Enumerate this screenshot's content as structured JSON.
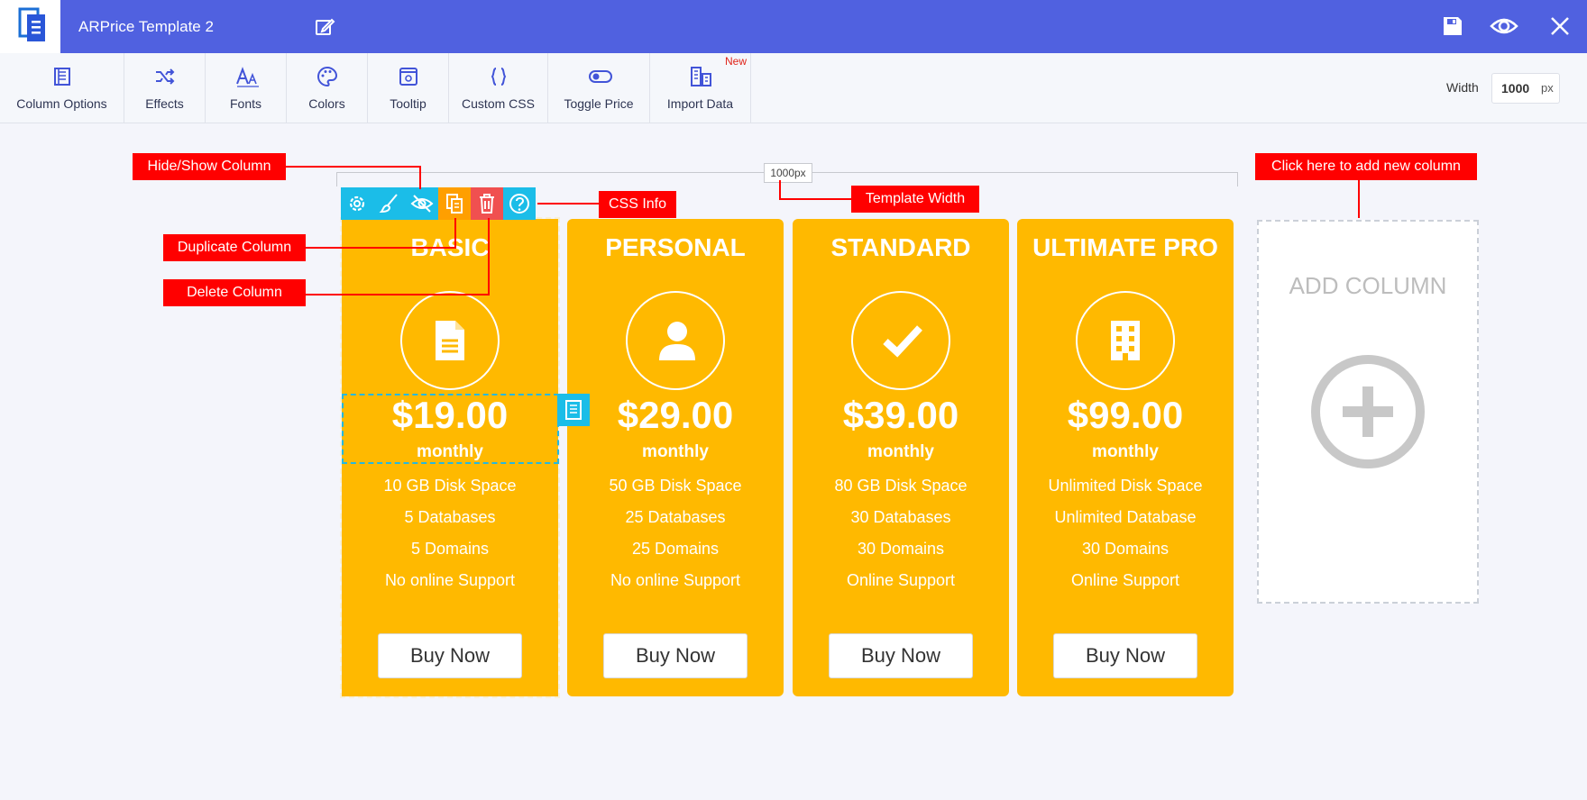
{
  "app": {
    "title": "ARPrice Template 2"
  },
  "toolbar": {
    "items": [
      {
        "label": "Column Options",
        "icon": "column-options-icon"
      },
      {
        "label": "Effects",
        "icon": "shuffle-icon"
      },
      {
        "label": "Fonts",
        "icon": "fonts-icon"
      },
      {
        "label": "Colors",
        "icon": "palette-icon"
      },
      {
        "label": "Tooltip",
        "icon": "tooltip-icon"
      },
      {
        "label": "Custom CSS",
        "icon": "braces-icon"
      },
      {
        "label": "Toggle Price",
        "icon": "toggle-icon"
      },
      {
        "label": "Import Data",
        "icon": "import-data-icon"
      }
    ],
    "new_badge": "New",
    "width_label": "Width",
    "width_value": "1000",
    "width_unit": "px"
  },
  "template_width_label": "1000px",
  "callouts": {
    "hide_show": "Hide/Show Column",
    "duplicate": "Duplicate Column",
    "delete": "Delete Column",
    "css_info": "CSS Info",
    "template_width": "Template Width",
    "add_new": "Click here to add new column"
  },
  "columns": [
    {
      "title": "BASIC",
      "icon": "document-icon",
      "price": "$19.00",
      "period": "monthly",
      "features": [
        "10 GB Disk Space",
        "5 Databases",
        "5 Domains",
        "No online Support"
      ],
      "button": "Buy Now"
    },
    {
      "title": "PERSONAL",
      "icon": "user-icon",
      "price": "$29.00",
      "period": "monthly",
      "features": [
        "50 GB Disk Space",
        "25 Databases",
        "25 Domains",
        "No online Support"
      ],
      "button": "Buy Now"
    },
    {
      "title": "STANDARD",
      "icon": "checkmark-icon",
      "price": "$39.00",
      "period": "monthly",
      "features": [
        "80 GB Disk Space",
        "30 Databases",
        "30 Domains",
        "Online Support"
      ],
      "button": "Buy Now"
    },
    {
      "title": "ULTIMATE PRO",
      "icon": "building-icon",
      "price": "$99.00",
      "period": "monthly",
      "features": [
        "Unlimited Disk Space",
        "Unlimited Database",
        "30 Domains",
        "Online Support"
      ],
      "button": "Buy Now"
    }
  ],
  "add_column": {
    "label": "ADD COLUMN"
  },
  "colors": {
    "header": "#5061e0",
    "column": "#ffb900",
    "callout": "#ff0000",
    "tool_blue": "#1bbde8",
    "tool_orange": "#ff9f00",
    "tool_red": "#f05050"
  }
}
